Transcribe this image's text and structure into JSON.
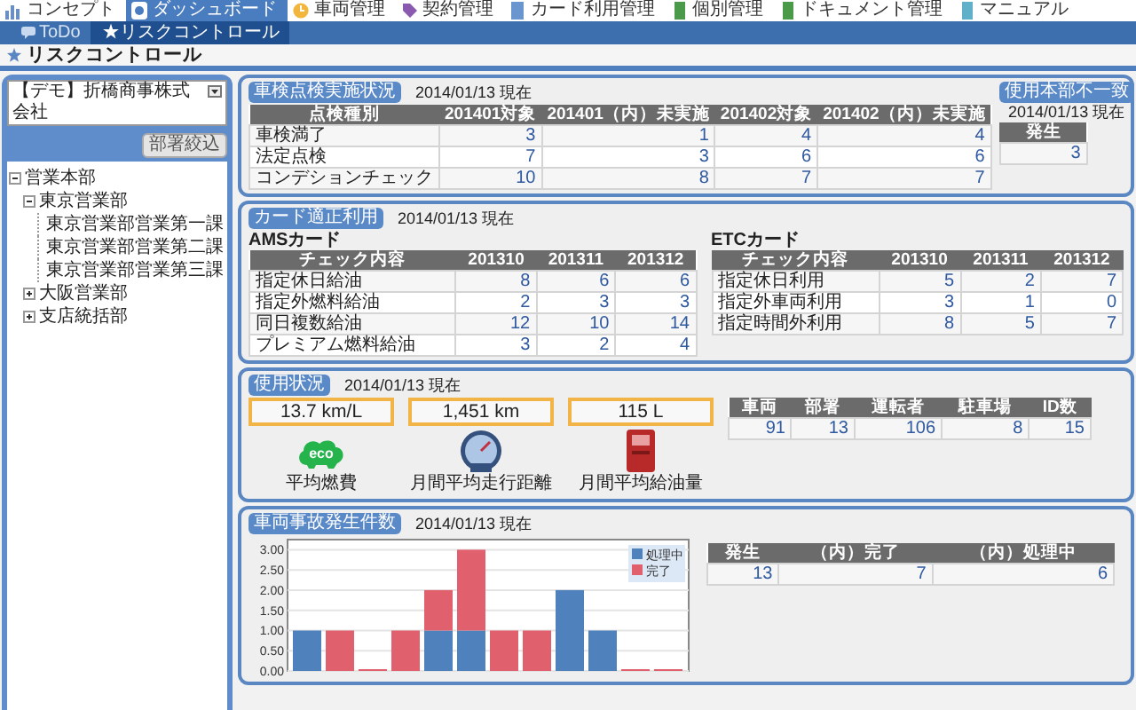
{
  "top_nav": [
    {
      "label": "コンセプト",
      "selected": false
    },
    {
      "label": "ダッシュボード",
      "selected": true
    },
    {
      "label": "車両管理",
      "selected": false
    },
    {
      "label": "契約管理",
      "selected": false
    },
    {
      "label": "カード利用管理",
      "selected": false
    },
    {
      "label": "個別管理",
      "selected": false
    },
    {
      "label": "ドキュメント管理",
      "selected": false
    },
    {
      "label": "マニュアル",
      "selected": false
    }
  ],
  "sub_tabs": [
    {
      "label": "ToDo",
      "selected": false
    },
    {
      "label": "★リスクコントロール",
      "selected": true
    }
  ],
  "page_title": "リスクコントロール",
  "sidebar": {
    "company_select": "【デモ】折橋商事株式会社",
    "filter_button": "部署絞込",
    "tree": [
      {
        "label": "営業本部",
        "expanded": true,
        "children": [
          {
            "label": "東京営業部",
            "expanded": true,
            "children": [
              {
                "label": "東京営業部営業第一課"
              },
              {
                "label": "東京営業部営業第二課"
              },
              {
                "label": "東京営業部営業第三課"
              }
            ]
          },
          {
            "label": "大阪営業部",
            "expanded": false
          },
          {
            "label": "支店統括部",
            "expanded": false
          }
        ]
      }
    ]
  },
  "inspection": {
    "badge": "車検点検実施状況",
    "date": "2014/01/13 現在",
    "table": {
      "columns": [
        "点検種別",
        "201401対象",
        "201401（内）未実施",
        "201402対象",
        "201402（内）未実施"
      ],
      "rows": [
        [
          "車検満了",
          "3",
          "1",
          "4",
          "4"
        ],
        [
          "法定点検",
          "7",
          "3",
          "6",
          "6"
        ],
        [
          "コンデションチェック",
          "10",
          "8",
          "7",
          "7"
        ]
      ]
    }
  },
  "mismatch": {
    "badge": "使用本部不一致",
    "date": "2014/01/13 現在",
    "table": {
      "columns": [
        "発生"
      ],
      "rows": [
        [
          "3"
        ]
      ]
    }
  },
  "card_usage": {
    "badge": "カード適正利用",
    "date": "2014/01/13 現在",
    "tables": [
      {
        "title": "AMSカード",
        "columns": [
          "チェック内容",
          "201310",
          "201311",
          "201312"
        ],
        "rows": [
          [
            "指定休日給油",
            "8",
            "6",
            "6"
          ],
          [
            "指定外燃料給油",
            "2",
            "3",
            "3"
          ],
          [
            "同日複数給油",
            "12",
            "10",
            "14"
          ],
          [
            "プレミアム燃料給油",
            "3",
            "2",
            "4"
          ]
        ]
      },
      {
        "title": "ETCカード",
        "columns": [
          "チェック内容",
          "201310",
          "201311",
          "201312"
        ],
        "rows": [
          [
            "指定休日利用",
            "5",
            "2",
            "7"
          ],
          [
            "指定外車両利用",
            "3",
            "1",
            "0"
          ],
          [
            "指定時間外利用",
            "8",
            "5",
            "7"
          ]
        ]
      }
    ]
  },
  "usage": {
    "badge": "使用状況",
    "date": "2014/01/13 現在",
    "metrics": [
      {
        "value": "13.7 km/L",
        "kind": "eco",
        "icon_text": "eco",
        "label": "平均燃費"
      },
      {
        "value": "1,451 km",
        "kind": "gauge",
        "label": "月間平均走行距離"
      },
      {
        "value": "115 L",
        "kind": "pump",
        "label": "月間平均給油量"
      }
    ],
    "table": {
      "columns": [
        "車両",
        "部署",
        "運転者",
        "駐車場",
        "ID数"
      ],
      "rows": [
        [
          "91",
          "13",
          "106",
          "8",
          "15"
        ]
      ]
    }
  },
  "accidents": {
    "badge": "車両事故発生件数",
    "date": "2014/01/13 現在",
    "chart_data": {
      "type": "bar",
      "stacked": true,
      "grid": true,
      "legend": true,
      "ylim": [
        0,
        3.25
      ],
      "yticks": [
        {
          "value": 0,
          "label": "0.00"
        },
        {
          "value": 0.5,
          "label": "0.50"
        },
        {
          "value": 1,
          "label": "1.00"
        },
        {
          "value": 1.5,
          "label": "1.50"
        },
        {
          "value": 2,
          "label": "2.00"
        },
        {
          "value": 2.5,
          "label": "2.50"
        },
        {
          "value": 3,
          "label": "3.00"
        }
      ],
      "series": [
        {
          "name": "処理中",
          "color": "#4f81bd",
          "values": [
            1,
            0,
            0,
            0,
            1,
            1,
            0,
            0,
            2,
            1,
            0,
            0
          ]
        },
        {
          "name": "完了",
          "color": "#e0606e",
          "values": [
            0,
            1,
            0,
            1,
            1,
            2,
            1,
            1,
            0,
            0,
            0,
            0
          ]
        }
      ]
    },
    "table": {
      "columns": [
        "発生",
        "（内）完了",
        "（内）処理中"
      ],
      "rows": [
        [
          "13",
          "7",
          "6"
        ]
      ]
    }
  }
}
